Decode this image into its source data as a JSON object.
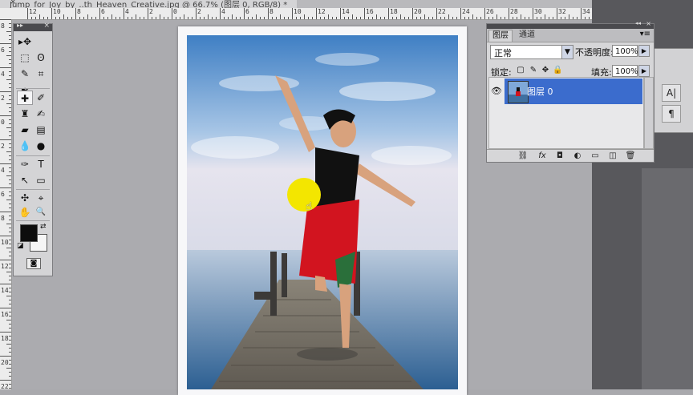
{
  "document": {
    "tab_title": "Jump_for_Joy_by_..th_Heaven_Creative.jpg @ 66.7% (图层 0, RGB/8) *",
    "close_label": "×"
  },
  "rulers": {
    "top": [
      "12",
      "10",
      "8",
      "6",
      "4",
      "2",
      "0",
      "2",
      "4",
      "6",
      "8",
      "10",
      "12",
      "14",
      "16",
      "18",
      "20",
      "22",
      "24",
      "26",
      "28",
      "30",
      "32",
      "34"
    ],
    "left": [
      "8",
      "6",
      "4",
      "2",
      "0",
      "2",
      "4",
      "6",
      "8",
      "10",
      "12",
      "14",
      "16",
      "18",
      "20",
      "22"
    ]
  },
  "toolbox": {
    "collapse_label": "▸▸",
    "close_label": "×",
    "tools": [
      {
        "name": "move-tool",
        "glyph": "▸✥"
      },
      {
        "name": "marquee-tool",
        "glyph": "⬚"
      },
      {
        "name": "lasso-tool",
        "glyph": "ʘ"
      },
      {
        "name": "quick-select-tool",
        "glyph": "✎"
      },
      {
        "name": "crop-tool",
        "glyph": "⌗"
      },
      {
        "name": "eyedropper-tool",
        "glyph": "✒"
      },
      {
        "name": "healing-tool",
        "glyph": "✚"
      },
      {
        "name": "brush-tool",
        "glyph": "✐"
      },
      {
        "name": "stamp-tool",
        "glyph": "♜"
      },
      {
        "name": "history-brush-tool",
        "glyph": "✍"
      },
      {
        "name": "eraser-tool",
        "glyph": "▰"
      },
      {
        "name": "gradient-tool",
        "glyph": "▤"
      },
      {
        "name": "blur-tool",
        "glyph": "💧"
      },
      {
        "name": "dodge-tool",
        "glyph": "●"
      },
      {
        "name": "pen-tool",
        "glyph": "✑"
      },
      {
        "name": "type-tool",
        "glyph": "T"
      },
      {
        "name": "path-select-tool",
        "glyph": "↖"
      },
      {
        "name": "shape-tool",
        "glyph": "▭"
      },
      {
        "name": "3d-rotate-tool",
        "glyph": "✣"
      },
      {
        "name": "3d-camera-tool",
        "glyph": "⌖"
      },
      {
        "name": "hand-tool",
        "glyph": "✋"
      },
      {
        "name": "zoom-tool",
        "glyph": "🔍"
      }
    ],
    "swap_label": "⇄",
    "default_label": "◪",
    "quickmask_label": "◙"
  },
  "layers_panel": {
    "tab_layers": "图层",
    "tab_channels": "通道",
    "menu_label": "▾≡",
    "collapse_label": "◂◂",
    "close_label": "×",
    "blend_mode": "正常",
    "opacity_label": "不透明度:",
    "opacity_value": "100%",
    "lock_label": "锁定:",
    "fill_label": "填充:",
    "fill_value": "100%",
    "layer_name": "图层 0",
    "footer_icons": [
      "⛓",
      "fx",
      "◘",
      "◐",
      "▭",
      "◫",
      "🗑"
    ]
  },
  "side_panel": {
    "buttons": [
      "A|",
      "¶"
    ]
  },
  "colors": {
    "foreground": "#0d0d0d",
    "background": "#f5f5f5",
    "selection": "#3b6ccd",
    "cursor_highlight": "#f3e600"
  }
}
